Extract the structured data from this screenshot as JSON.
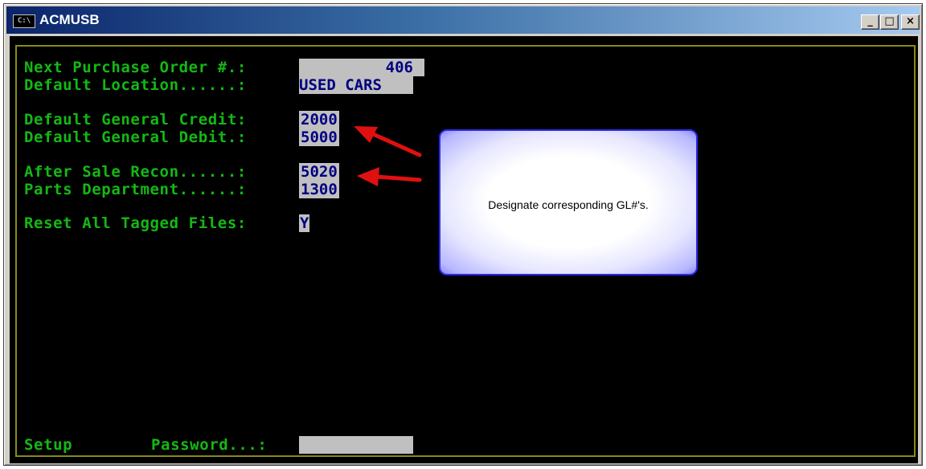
{
  "window": {
    "title": "ACMUSB",
    "icon_label": "C:\\",
    "minimize_label": "_",
    "maximize_label": "□",
    "close_label": "×"
  },
  "form": {
    "rows": [
      {
        "label": "Next Purchase Order #.:",
        "value": "406"
      },
      {
        "label": "Default Location......:",
        "value": "USED CARS"
      },
      {
        "label": "Default General Credit:",
        "value": "2000"
      },
      {
        "label": "Default General Debit.:",
        "value": "5000"
      },
      {
        "label": "After Sale Recon......:",
        "value": "5020"
      },
      {
        "label": "Parts Department......:",
        "value": "1300"
      },
      {
        "label": "Reset All Tagged Files:",
        "value": "Y"
      }
    ],
    "footer_mode": "Setup",
    "password_label": "Password...:",
    "password_value": ""
  },
  "callout": {
    "text": "Designate corresponding GL#'s."
  },
  "colors": {
    "console_bg": "#000000",
    "label_green": "#14b814",
    "field_text": "#000080",
    "field_bg": "#c0c0c0",
    "frame": "#8a8a1a",
    "arrow": "#e01010",
    "callout_border": "#2a2ae6"
  }
}
